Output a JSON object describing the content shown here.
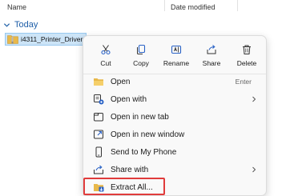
{
  "columns": {
    "name": "Name",
    "date_modified": "Date modified"
  },
  "group": {
    "label": "Today"
  },
  "file": {
    "name": "i4311_Printer_Driver"
  },
  "quick_actions": [
    {
      "label": "Cut",
      "icon": "scissors-icon"
    },
    {
      "label": "Copy",
      "icon": "copy-icon"
    },
    {
      "label": "Rename",
      "icon": "rename-icon"
    },
    {
      "label": "Share",
      "icon": "share-icon"
    },
    {
      "label": "Delete",
      "icon": "trash-icon"
    }
  ],
  "menu_items": [
    {
      "label": "Open",
      "shortcut": "Enter",
      "icon": "folder-open-icon"
    },
    {
      "label": "Open with",
      "icon": "open-with-icon",
      "submenu": true
    },
    {
      "label": "Open in new tab",
      "icon": "new-tab-icon"
    },
    {
      "label": "Open in new window",
      "icon": "new-window-icon"
    },
    {
      "label": "Send to My Phone",
      "icon": "phone-icon"
    },
    {
      "label": "Share with",
      "icon": "share-with-icon",
      "submenu": true
    },
    {
      "label": "Extract All...",
      "icon": "extract-icon",
      "highlighted": true
    }
  ],
  "colors": {
    "accent": "#1f5fa8",
    "selection": "#cce4f7",
    "highlight_border": "#e03b3b"
  }
}
